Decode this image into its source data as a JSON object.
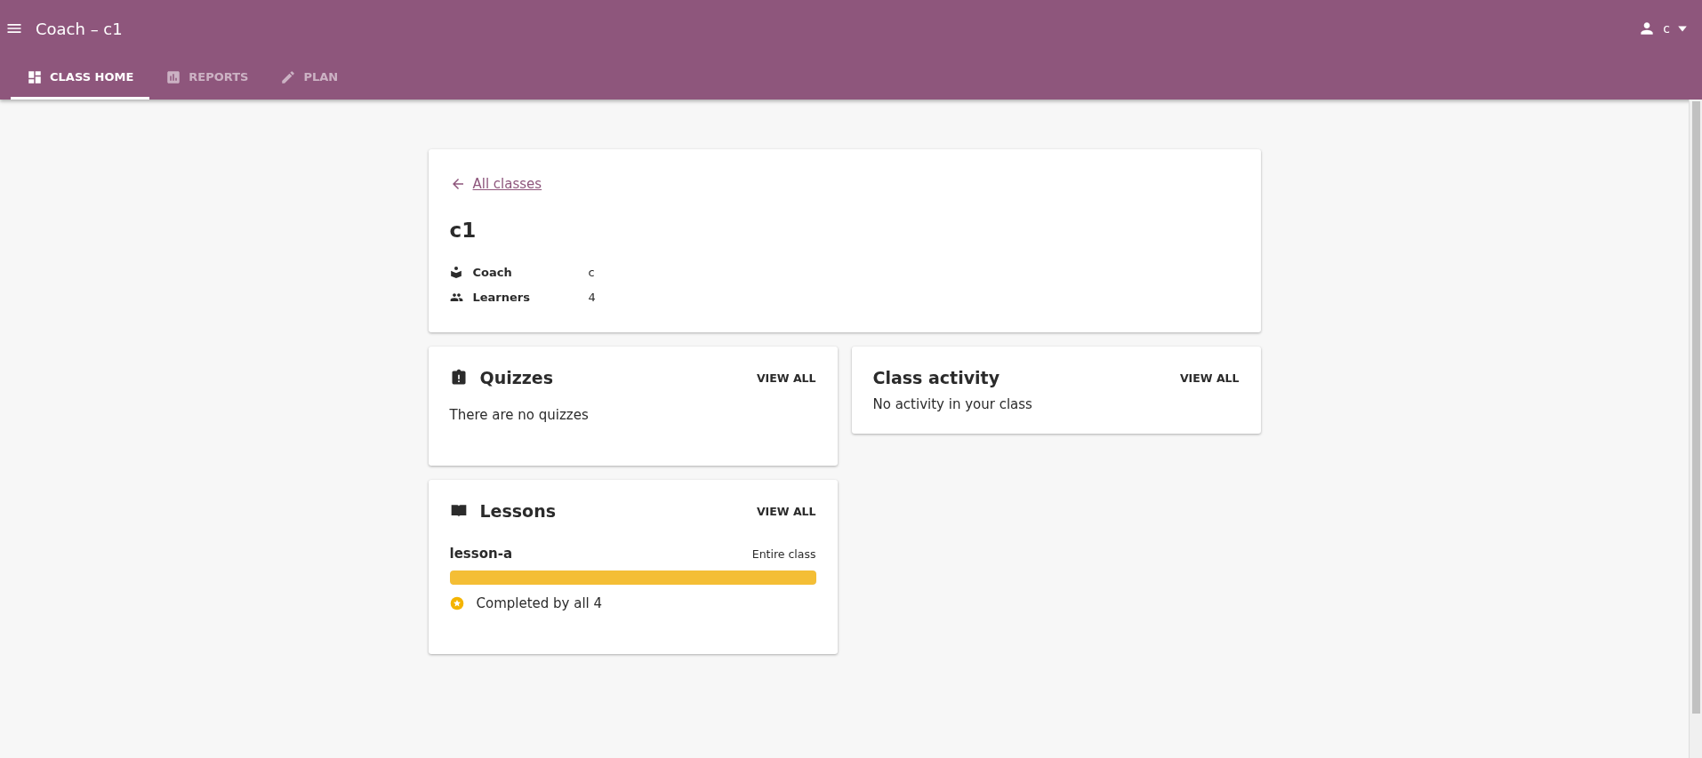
{
  "app_bar": {
    "title": "Coach – c1",
    "user": "c"
  },
  "tabs": [
    {
      "label": "CLASS HOME",
      "kind": "dashboard",
      "selected": true
    },
    {
      "label": "REPORTS",
      "kind": "chart",
      "selected": false
    },
    {
      "label": "PLAN",
      "kind": "pencil",
      "selected": false
    }
  ],
  "class_card": {
    "back_link": "All classes",
    "name": "c1",
    "details": [
      {
        "kind": "coach",
        "label": "Coach",
        "value": "c"
      },
      {
        "kind": "people",
        "label": "Learners",
        "value": "4"
      }
    ]
  },
  "quizzes": {
    "title": "Quizzes",
    "action": "VIEW ALL",
    "empty": "There are no quizzes"
  },
  "class_activity": {
    "title": "Class activity",
    "action": "VIEW ALL",
    "empty": "No activity in your class"
  },
  "lessons": {
    "title": "Lessons",
    "action": "VIEW ALL",
    "items": [
      {
        "name": "lesson-a",
        "assigned": "Entire class",
        "level": 1,
        "status": "Completed by all 4"
      }
    ]
  }
}
